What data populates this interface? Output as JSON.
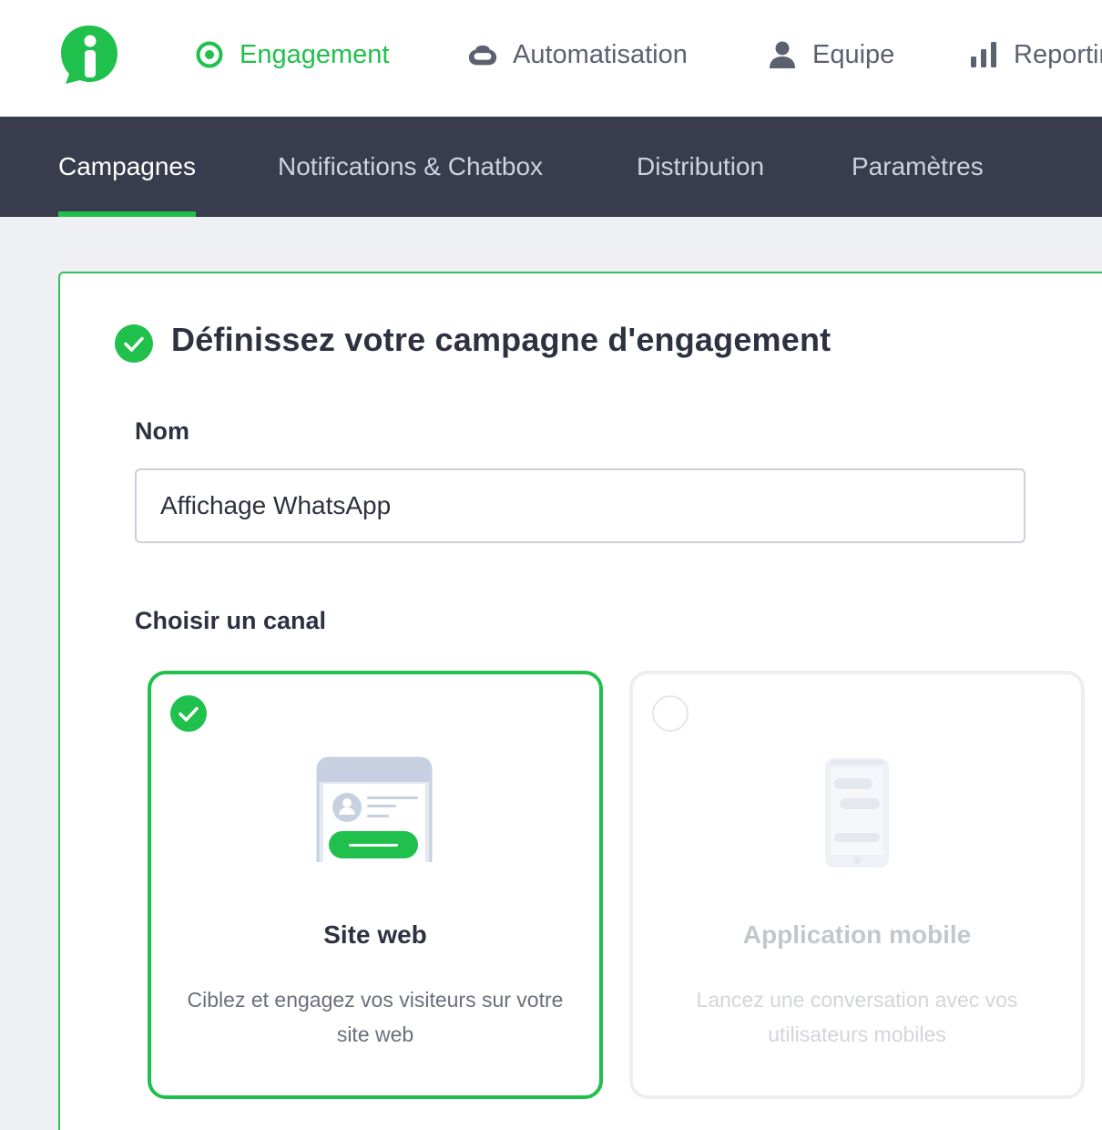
{
  "colors": {
    "accent": "#1fc14c",
    "subnav_bg": "#383c4c",
    "page_bg": "#eef0f4"
  },
  "topnav": {
    "items": [
      {
        "label": "Engagement",
        "icon": "target-icon",
        "active": true
      },
      {
        "label": "Automatisation",
        "icon": "robot-icon",
        "active": false
      },
      {
        "label": "Equipe",
        "icon": "user-icon",
        "active": false
      },
      {
        "label": "Reporting",
        "icon": "bar-chart-icon",
        "active": false
      }
    ]
  },
  "subnav": {
    "tabs": [
      {
        "label": "Campagnes",
        "active": true
      },
      {
        "label": "Notifications & Chatbox",
        "active": false
      },
      {
        "label": "Distribution",
        "active": false
      },
      {
        "label": "Paramètres",
        "active": false
      }
    ]
  },
  "main": {
    "section_title": "Définissez votre campagne d'engagement",
    "name_label": "Nom",
    "name_value": "Affichage WhatsApp",
    "channel_label": "Choisir un canal",
    "channels": [
      {
        "title": "Site web",
        "description": "Ciblez et engagez vos visiteurs sur votre site web",
        "selected": true,
        "icon": "website-illustration"
      },
      {
        "title": "Application mobile",
        "description": "Lancez une conversation avec vos utilisateurs mobiles",
        "selected": false,
        "icon": "mobile-app-illustration"
      }
    ]
  }
}
